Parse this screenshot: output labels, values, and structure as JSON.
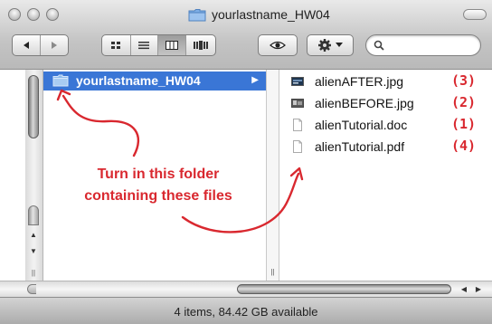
{
  "window": {
    "title": "yourlastname_HW04",
    "traffic_lights": [
      "close",
      "minimize",
      "zoom"
    ]
  },
  "toolbar": {
    "back_icon": "triangle-left",
    "forward_icon": "triangle-right",
    "view_buttons": [
      "icon-view",
      "list-view",
      "column-view",
      "cover-flow-view"
    ],
    "active_view": "column-view",
    "quick_look_icon": "eye",
    "action_icon": "gear-with-dropdown",
    "search": {
      "value": "",
      "placeholder": ""
    }
  },
  "sidebar_column": {
    "selected_folder": "yourlastname_HW04"
  },
  "files": [
    {
      "name": "alienAFTER.jpg",
      "number": "(3)",
      "icon": "jpg-thumbnail"
    },
    {
      "name": "alienBEFORE.jpg",
      "number": "(2)",
      "icon": "jpg-thumbnail"
    },
    {
      "name": "alienTutorial.doc",
      "number": "(1)",
      "icon": "document"
    },
    {
      "name": "alienTutorial.pdf",
      "number": "(4)",
      "icon": "document"
    }
  ],
  "annotation": {
    "text": "Turn in this folder\ncontaining these files",
    "color": "#d9282f"
  },
  "status_bar": {
    "text": "4 items, 84.42 GB available"
  },
  "colors": {
    "selection": "#3a76d6",
    "annotation": "#d9282f"
  }
}
